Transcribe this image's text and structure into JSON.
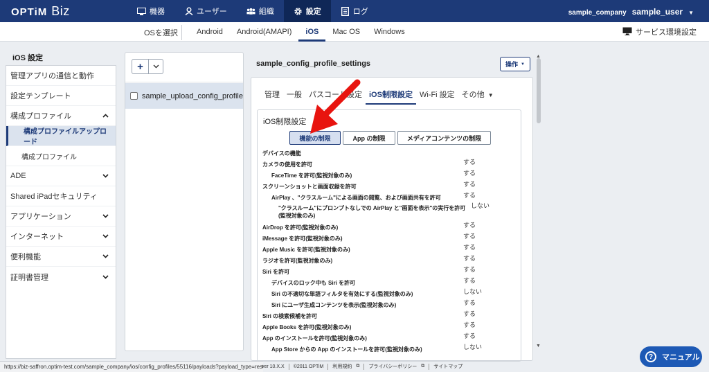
{
  "app": {
    "logo_main": "OPTiM",
    "logo_sub": "Biz"
  },
  "nav": {
    "items": [
      {
        "label": "機器",
        "icon": "device-icon"
      },
      {
        "label": "ユーザー",
        "icon": "user-icon"
      },
      {
        "label": "組織",
        "icon": "organization-icon"
      },
      {
        "label": "設定",
        "icon": "gear-icon",
        "active": true
      },
      {
        "label": "ログ",
        "icon": "log-icon"
      }
    ],
    "company": "sample_company",
    "user": "sample_user"
  },
  "os_bar": {
    "select_label": "OSを選択",
    "tabs": [
      "Android",
      "Android(AMAPI)",
      "iOS",
      "Mac OS",
      "Windows"
    ],
    "active_tab": "iOS",
    "env_settings": "サービス環境設定"
  },
  "sidebar": {
    "title": "iOS 設定",
    "items": [
      {
        "label": "管理アプリの通信と動作",
        "chevron": ""
      },
      {
        "label": "設定テンプレート",
        "chevron": ""
      },
      {
        "label": "構成プロファイル",
        "chevron": "up"
      },
      {
        "label": "構成プロファイルアップロード",
        "chevron": "",
        "sub": true,
        "active": true
      },
      {
        "label": "構成プロファイル",
        "chevron": "",
        "sub": true
      },
      {
        "label": "ADE",
        "chevron": "down"
      },
      {
        "label": "Shared iPadセキュリティ",
        "chevron": ""
      },
      {
        "label": "アプリケーション",
        "chevron": "down"
      },
      {
        "label": "インターネット",
        "chevron": "down"
      },
      {
        "label": "便利機能",
        "chevron": "down"
      },
      {
        "label": "証明書管理",
        "chevron": "down"
      }
    ]
  },
  "list": {
    "add_label": "+",
    "items": [
      {
        "label": "sample_upload_config_profile"
      }
    ]
  },
  "main": {
    "profile_name": "sample_config_profile_settings",
    "ops_label": "操作",
    "tabs": [
      "管理",
      "一般",
      "パスコード設定",
      "iOS制限設定",
      "Wi-Fi 設定",
      "その他"
    ],
    "active_tab": "iOS制限設定",
    "section_title": "iOS制限設定",
    "segments": [
      "機能の制限",
      "App の制限",
      "メディアコンテンツの制限"
    ],
    "active_segment": "機能の制限",
    "rows": [
      {
        "label": "デバイスの機能",
        "value": "",
        "indent": 0
      },
      {
        "label": "カメラの使用を許可",
        "value": "する",
        "indent": 0
      },
      {
        "label": "FaceTime を許可(監視対象のみ)",
        "value": "する",
        "indent": 1
      },
      {
        "label": "スクリーンショットと画面収録を許可",
        "value": "する",
        "indent": 0
      },
      {
        "label": "AirPlay 、\"クラスルーム\"による画面の閲覧、および画面共有を許可",
        "value": "する",
        "indent": 1
      },
      {
        "label": "\"クラスルーム\"にプロンプトなしでの AirPlay と\"画面を表示\"の実行を許可(監視対象のみ)",
        "value": "しない",
        "indent": 2
      },
      {
        "label": "AirDrop を許可(監視対象のみ)",
        "value": "する",
        "indent": 0
      },
      {
        "label": "iMessage を許可(監視対象のみ)",
        "value": "する",
        "indent": 0
      },
      {
        "label": "Apple Music を許可(監視対象のみ)",
        "value": "する",
        "indent": 0
      },
      {
        "label": "ラジオを許可(監視対象のみ)",
        "value": "する",
        "indent": 0
      },
      {
        "label": "Siri を許可",
        "value": "する",
        "indent": 0
      },
      {
        "label": "デバイスのロック中も Siri を許可",
        "value": "する",
        "indent": 1
      },
      {
        "label": "Siri の不適切な単語フィルタを有効にする(監視対象のみ)",
        "value": "しない",
        "indent": 1
      },
      {
        "label": "Siri にユーザ生成コンテンツを表示(監視対象のみ)",
        "value": "する",
        "indent": 1
      },
      {
        "label": "Siri の検索候補を許可",
        "value": "する",
        "indent": 0
      },
      {
        "label": "Apple Books を許可(監視対象のみ)",
        "value": "する",
        "indent": 0
      },
      {
        "label": "App のインストールを許可(監視対象のみ)",
        "value": "する",
        "indent": 0
      },
      {
        "label": "App Store からの App のインストールを許可(監視対象のみ)",
        "value": "しない",
        "indent": 1
      }
    ]
  },
  "statusbar": {
    "url": "https://biz-saffron.optim-test.com/sample_company/ios/config_profiles/55116/payloads?payload_type=restrictions"
  },
  "footer": {
    "version": "ver 10.X.X",
    "copyright": "©2011 OPTiM",
    "terms": "利用規約",
    "privacy": "プライバシーポリシー",
    "sitemap": "サイトマップ"
  },
  "manual": {
    "label": "マニュアル"
  },
  "colors": {
    "header": "#1d3a78",
    "accent": "#1d59b5",
    "arrow": "#e8140f"
  }
}
